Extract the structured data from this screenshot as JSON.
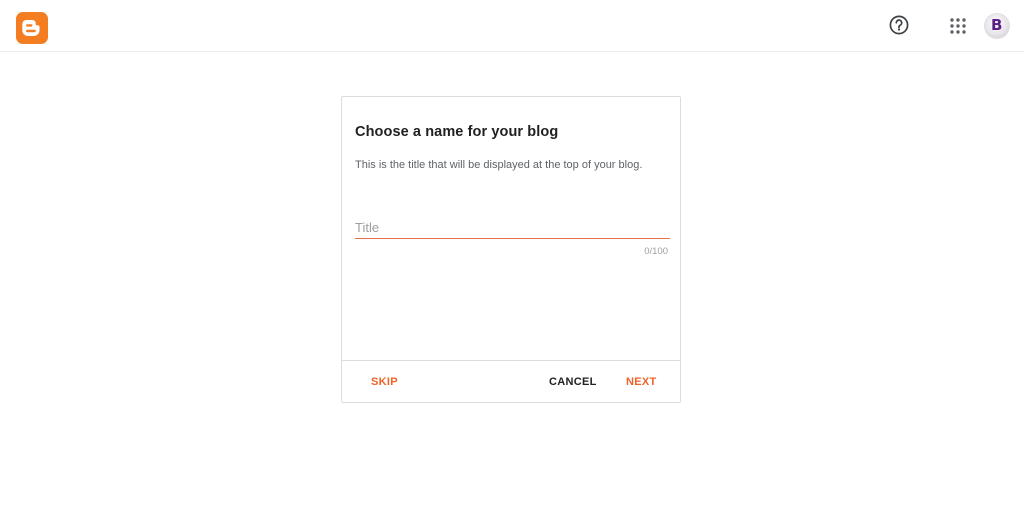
{
  "header": {
    "logo_icon": "blogger-logo-icon",
    "brand_color": "#f57d21",
    "help_icon": "help-circle-icon",
    "apps_icon": "apps-grid-icon",
    "avatar_letter": "B"
  },
  "dialog": {
    "title": "Choose a name for your blog",
    "subtitle": "This is the title that will be displayed at the top of your blog.",
    "input": {
      "value": "",
      "placeholder": "Title",
      "counter": "0/100"
    },
    "buttons": {
      "skip": "SKIP",
      "cancel": "CANCEL",
      "next": "NEXT"
    },
    "accent_color": "#f0622a"
  }
}
